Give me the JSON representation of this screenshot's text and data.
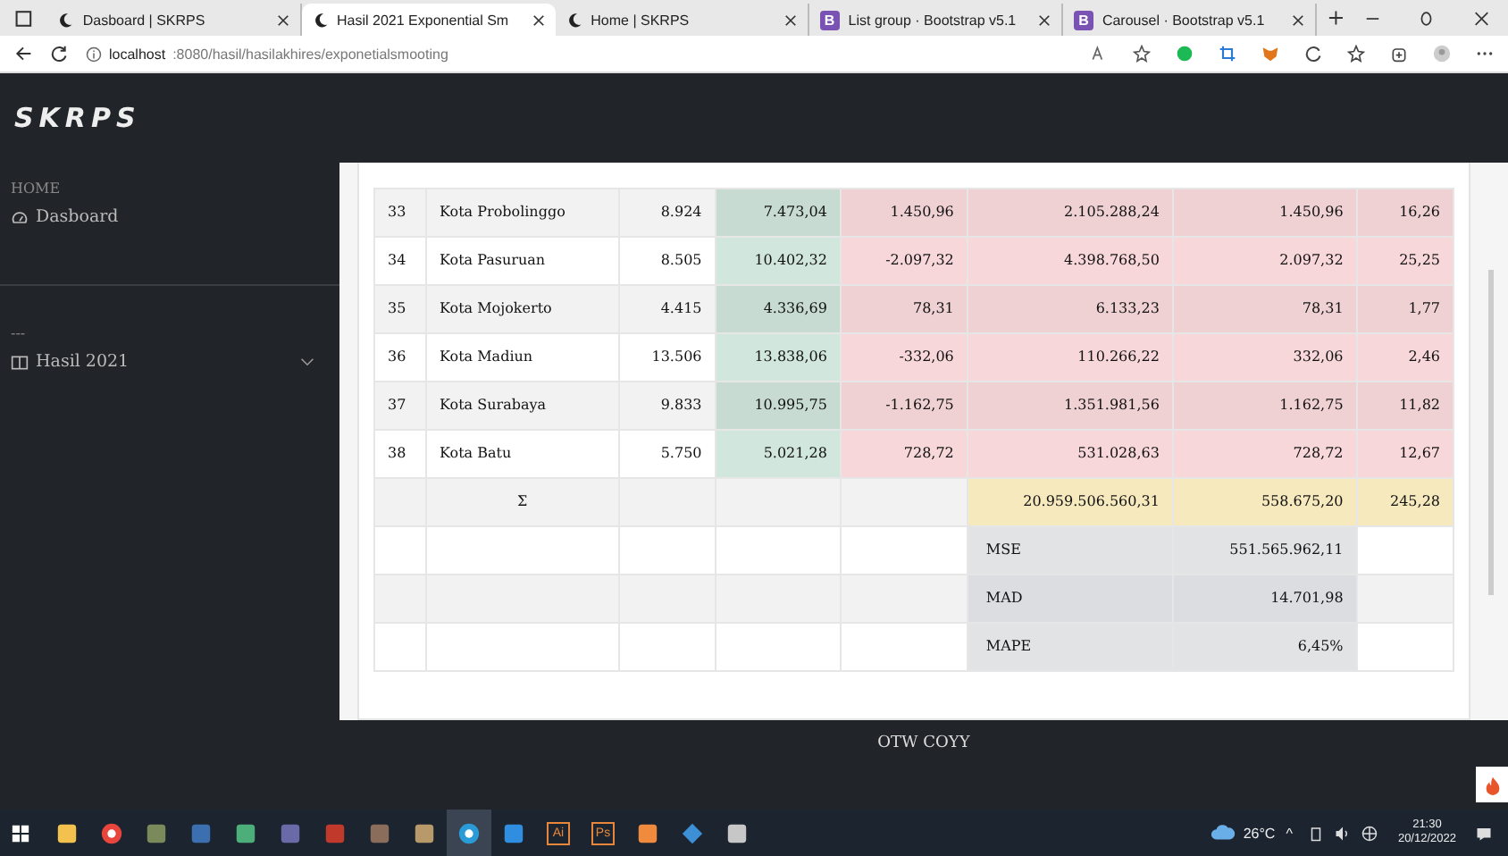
{
  "browser": {
    "tabs": [
      {
        "title": "Dasboard | SKRPS",
        "kind": "moon",
        "selected": false
      },
      {
        "title": "Hasil 2021 Exponential Sm",
        "kind": "moon",
        "selected": true
      },
      {
        "title": "Home | SKRPS",
        "kind": "moon",
        "selected": false
      },
      {
        "title": "List group · Bootstrap v5.1",
        "kind": "letter",
        "icon_text": "B",
        "selected": false
      },
      {
        "title": "Carousel · Bootstrap v5.1",
        "kind": "letter",
        "icon_text": "B",
        "selected": false
      }
    ],
    "address": {
      "host": "localhost",
      "rest": ":8080/hasil/hasilakhires/exponetialsmooting"
    }
  },
  "app": {
    "logo": "SKRPS",
    "sidebar": {
      "sections": [
        {
          "heading": "HOME",
          "items": [
            {
              "label": "Dasboard",
              "kind": "gauge",
              "expandable": false
            }
          ]
        },
        {
          "heading": "---",
          "items": [
            {
              "label": "Hasil 2021",
              "kind": "book",
              "expandable": true
            }
          ]
        }
      ]
    },
    "table": {
      "rows": [
        {
          "kind": "data",
          "cells": [
            "33",
            "Kota Probolinggo",
            "8.924",
            "7.473,04",
            "1.450,96",
            "2.105.288,24",
            "1.450,96",
            "16,26"
          ]
        },
        {
          "kind": "data",
          "cells": [
            "34",
            "Kota Pasuruan",
            "8.505",
            "10.402,32",
            "-2.097,32",
            "4.398.768,50",
            "2.097,32",
            "25,25"
          ]
        },
        {
          "kind": "data",
          "cells": [
            "35",
            "Kota Mojokerto",
            "4.415",
            "4.336,69",
            "78,31",
            "6.133,23",
            "78,31",
            "1,77"
          ]
        },
        {
          "kind": "data",
          "cells": [
            "36",
            "Kota Madiun",
            "13.506",
            "13.838,06",
            "-332,06",
            "110.266,22",
            "332,06",
            "2,46"
          ]
        },
        {
          "kind": "data",
          "cells": [
            "37",
            "Kota Surabaya",
            "9.833",
            "10.995,75",
            "-1.162,75",
            "1.351.981,56",
            "1.162,75",
            "11,82"
          ]
        },
        {
          "kind": "data",
          "cells": [
            "38",
            "Kota Batu",
            "5.750",
            "5.021,28",
            "728,72",
            "531.028,63",
            "728,72",
            "12,67"
          ]
        },
        {
          "kind": "sum",
          "symbol": "Σ",
          "cells": [
            "20.959.506.560,31",
            "558.675,20",
            "245,28"
          ]
        },
        {
          "kind": "metric",
          "label": "MSE",
          "value": "551.565.962,11"
        },
        {
          "kind": "metric",
          "label": "MAD",
          "value": "14.701,98"
        },
        {
          "kind": "metric",
          "label": "MAPE",
          "value": "6,45%"
        }
      ]
    },
    "footer": "OTW COYY"
  },
  "taskbar": {
    "apps": [
      {
        "kind": "folder",
        "active": false
      },
      {
        "kind": "chrome",
        "active": false
      },
      {
        "kind": "game",
        "active": false
      },
      {
        "kind": "game2",
        "active": false
      },
      {
        "kind": "shield",
        "active": false
      },
      {
        "kind": "game3",
        "active": false
      },
      {
        "kind": "cross",
        "active": false
      },
      {
        "kind": "figure",
        "active": false
      },
      {
        "kind": "horse",
        "active": false
      },
      {
        "kind": "edge",
        "active": true
      },
      {
        "kind": "code",
        "active": false
      },
      {
        "kind": "label",
        "text": "Ai",
        "active": false
      },
      {
        "kind": "label",
        "text": "Ps",
        "active": false
      },
      {
        "kind": "xampp",
        "active": false
      },
      {
        "kind": "diamond",
        "active": false
      },
      {
        "kind": "brush",
        "active": false
      }
    ],
    "weather": "26°C",
    "tray_caret": "^",
    "time": "21:30",
    "date": "20/12/2022"
  }
}
